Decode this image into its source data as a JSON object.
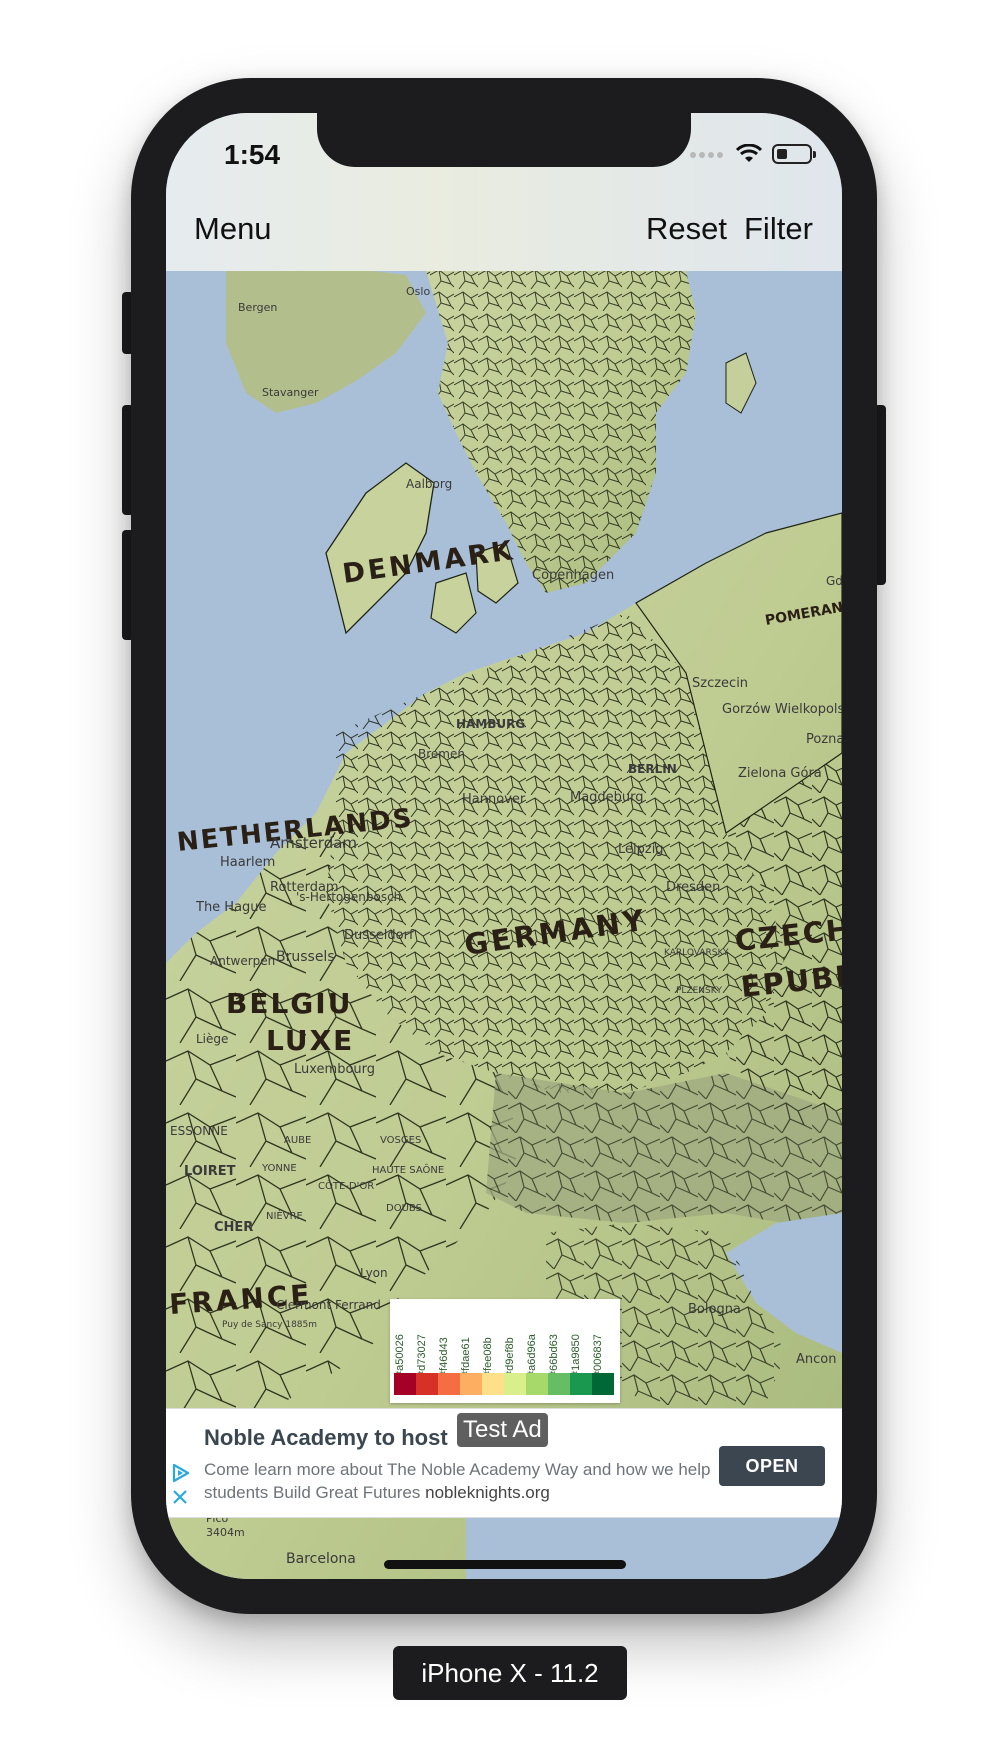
{
  "status_bar": {
    "time": "1:54"
  },
  "navbar": {
    "menu_label": "Menu",
    "reset_label": "Reset",
    "filter_label": "Filter"
  },
  "map": {
    "labels": {
      "denmark": "DENMARK",
      "netherlands": "NETHERLANDS",
      "germany": "GERMANY",
      "belgium": "BELGIU",
      "luxembourg": "LUXE",
      "france": "FRANCE",
      "czech": "CZECH",
      "republic": "EPUBL",
      "pomerania": "POMERANIA",
      "bergen": "Bergen",
      "oslo": "Oslo",
      "stavanger": "Stavanger",
      "aalborg": "Aalborg",
      "copenhagen": "Copenhagen",
      "szczecin": "Szczecin",
      "gorzow": "Gorzów Wielkopolski",
      "poznan": "Poznań",
      "zielona_gora": "Zielona Góra",
      "hamburg": "HAMBURG",
      "bremen": "Bremen",
      "hannover": "Hannover",
      "magdeburg": "Magdeburg",
      "berlin": "BERLIN",
      "leipzig": "Leipzig",
      "dresden": "Dresden",
      "amsterdam": "Amsterdam",
      "haarlem": "Haarlem",
      "rotterdam": "Rotterdam",
      "the_hague": "The Hague",
      "s_hertogenbosch": "'s-Hertogenbosch",
      "antwerpen": "Antwerpen",
      "brussels": "Brussels",
      "dusseldorf": "Dusseldorf",
      "liege": "Liège",
      "luxembourg_city": "Luxembourg",
      "essonne": "ESSONNE",
      "loiret": "LOIRET",
      "yonne": "YONNE",
      "cote_dor": "CÔTE-D'OR",
      "aube": "AUBE",
      "vosges": "VOSGES",
      "haute_saone": "HAUTE SAÔNE",
      "doubs": "DOUBS",
      "nievre": "NIÈVRE",
      "cher": "CHER",
      "clermont": "Clermont Ferrand",
      "lyon": "Lyon",
      "bologna": "Bologna",
      "barcelona": "Barcelona",
      "ancona": "Ancon",
      "gd": "Gd",
      "plzensky": "PLZENSKY",
      "karlovarsky": "KARLOVARSKY",
      "pico": "Pico",
      "pico_height": "3404m",
      "puy_de_sancy": "Puy de Sancy 1885m"
    }
  },
  "legend": {
    "colors": [
      "#a50026",
      "#d73027",
      "#f46d43",
      "#fdae61",
      "#fee08b",
      "#d9ef8b",
      "#a6d96a",
      "#66bd63",
      "#1a9850",
      "#006837"
    ]
  },
  "ad": {
    "title": "Noble Academy to host",
    "body": "Come learn more about The Noble Academy Way and how we help students Build Great Futures",
    "domain": "nobleknights.org",
    "cta": "OPEN",
    "badge": "Test Ad"
  },
  "device_caption": "iPhone X - 11.2"
}
